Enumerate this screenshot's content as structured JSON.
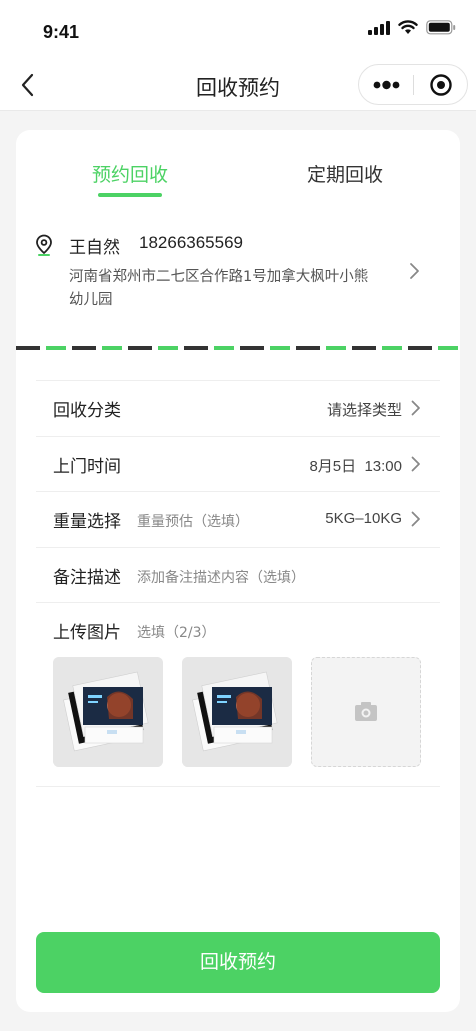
{
  "status_bar": {
    "time": "9:41"
  },
  "nav": {
    "title": "回收预约"
  },
  "tabs": [
    {
      "label": "预约回收",
      "active": true
    },
    {
      "label": "定期回收",
      "active": false
    }
  ],
  "address": {
    "name": "王自然",
    "phone": "18266365569",
    "detail": "河南省郑州市二七区合作路1号加拿大枫叶小熊幼儿园"
  },
  "form": {
    "category": {
      "label": "回收分类",
      "value": "请选择类型"
    },
    "time": {
      "label": "上门时间",
      "value": "8月5日  13:00"
    },
    "weight": {
      "label": "重量选择",
      "hint": "重量预估（选填）",
      "value": "5KG–10KG"
    },
    "remark": {
      "label": "备注描述",
      "hint": "添加备注描述内容（选填）"
    },
    "upload": {
      "label": "上传图片",
      "hint": "选填（2/3）"
    }
  },
  "submit_label": "回收预约",
  "colors": {
    "accent": "#4cd264",
    "stripe_dark": "#333333"
  },
  "icons": [
    "signal-icon",
    "wifi-icon",
    "battery-icon",
    "back-icon",
    "more-dots-icon",
    "target-icon",
    "location-pin-icon",
    "chevron-right-icon",
    "camera-icon"
  ]
}
